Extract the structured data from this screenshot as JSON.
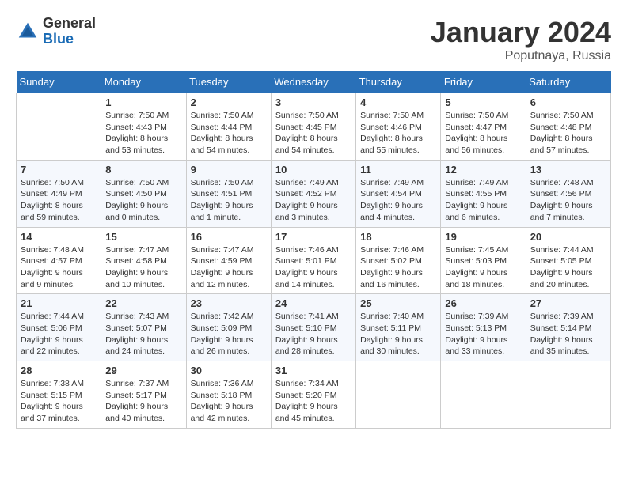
{
  "header": {
    "logo_general": "General",
    "logo_blue": "Blue",
    "month": "January 2024",
    "location": "Poputnaya, Russia"
  },
  "days_of_week": [
    "Sunday",
    "Monday",
    "Tuesday",
    "Wednesday",
    "Thursday",
    "Friday",
    "Saturday"
  ],
  "weeks": [
    [
      {
        "day": "",
        "sunrise": "",
        "sunset": "",
        "daylight": ""
      },
      {
        "day": "1",
        "sunrise": "Sunrise: 7:50 AM",
        "sunset": "Sunset: 4:43 PM",
        "daylight": "Daylight: 8 hours and 53 minutes."
      },
      {
        "day": "2",
        "sunrise": "Sunrise: 7:50 AM",
        "sunset": "Sunset: 4:44 PM",
        "daylight": "Daylight: 8 hours and 54 minutes."
      },
      {
        "day": "3",
        "sunrise": "Sunrise: 7:50 AM",
        "sunset": "Sunset: 4:45 PM",
        "daylight": "Daylight: 8 hours and 54 minutes."
      },
      {
        "day": "4",
        "sunrise": "Sunrise: 7:50 AM",
        "sunset": "Sunset: 4:46 PM",
        "daylight": "Daylight: 8 hours and 55 minutes."
      },
      {
        "day": "5",
        "sunrise": "Sunrise: 7:50 AM",
        "sunset": "Sunset: 4:47 PM",
        "daylight": "Daylight: 8 hours and 56 minutes."
      },
      {
        "day": "6",
        "sunrise": "Sunrise: 7:50 AM",
        "sunset": "Sunset: 4:48 PM",
        "daylight": "Daylight: 8 hours and 57 minutes."
      }
    ],
    [
      {
        "day": "7",
        "sunrise": "Sunrise: 7:50 AM",
        "sunset": "Sunset: 4:49 PM",
        "daylight": "Daylight: 8 hours and 59 minutes."
      },
      {
        "day": "8",
        "sunrise": "Sunrise: 7:50 AM",
        "sunset": "Sunset: 4:50 PM",
        "daylight": "Daylight: 9 hours and 0 minutes."
      },
      {
        "day": "9",
        "sunrise": "Sunrise: 7:50 AM",
        "sunset": "Sunset: 4:51 PM",
        "daylight": "Daylight: 9 hours and 1 minute."
      },
      {
        "day": "10",
        "sunrise": "Sunrise: 7:49 AM",
        "sunset": "Sunset: 4:52 PM",
        "daylight": "Daylight: 9 hours and 3 minutes."
      },
      {
        "day": "11",
        "sunrise": "Sunrise: 7:49 AM",
        "sunset": "Sunset: 4:54 PM",
        "daylight": "Daylight: 9 hours and 4 minutes."
      },
      {
        "day": "12",
        "sunrise": "Sunrise: 7:49 AM",
        "sunset": "Sunset: 4:55 PM",
        "daylight": "Daylight: 9 hours and 6 minutes."
      },
      {
        "day": "13",
        "sunrise": "Sunrise: 7:48 AM",
        "sunset": "Sunset: 4:56 PM",
        "daylight": "Daylight: 9 hours and 7 minutes."
      }
    ],
    [
      {
        "day": "14",
        "sunrise": "Sunrise: 7:48 AM",
        "sunset": "Sunset: 4:57 PM",
        "daylight": "Daylight: 9 hours and 9 minutes."
      },
      {
        "day": "15",
        "sunrise": "Sunrise: 7:47 AM",
        "sunset": "Sunset: 4:58 PM",
        "daylight": "Daylight: 9 hours and 10 minutes."
      },
      {
        "day": "16",
        "sunrise": "Sunrise: 7:47 AM",
        "sunset": "Sunset: 4:59 PM",
        "daylight": "Daylight: 9 hours and 12 minutes."
      },
      {
        "day": "17",
        "sunrise": "Sunrise: 7:46 AM",
        "sunset": "Sunset: 5:01 PM",
        "daylight": "Daylight: 9 hours and 14 minutes."
      },
      {
        "day": "18",
        "sunrise": "Sunrise: 7:46 AM",
        "sunset": "Sunset: 5:02 PM",
        "daylight": "Daylight: 9 hours and 16 minutes."
      },
      {
        "day": "19",
        "sunrise": "Sunrise: 7:45 AM",
        "sunset": "Sunset: 5:03 PM",
        "daylight": "Daylight: 9 hours and 18 minutes."
      },
      {
        "day": "20",
        "sunrise": "Sunrise: 7:44 AM",
        "sunset": "Sunset: 5:05 PM",
        "daylight": "Daylight: 9 hours and 20 minutes."
      }
    ],
    [
      {
        "day": "21",
        "sunrise": "Sunrise: 7:44 AM",
        "sunset": "Sunset: 5:06 PM",
        "daylight": "Daylight: 9 hours and 22 minutes."
      },
      {
        "day": "22",
        "sunrise": "Sunrise: 7:43 AM",
        "sunset": "Sunset: 5:07 PM",
        "daylight": "Daylight: 9 hours and 24 minutes."
      },
      {
        "day": "23",
        "sunrise": "Sunrise: 7:42 AM",
        "sunset": "Sunset: 5:09 PM",
        "daylight": "Daylight: 9 hours and 26 minutes."
      },
      {
        "day": "24",
        "sunrise": "Sunrise: 7:41 AM",
        "sunset": "Sunset: 5:10 PM",
        "daylight": "Daylight: 9 hours and 28 minutes."
      },
      {
        "day": "25",
        "sunrise": "Sunrise: 7:40 AM",
        "sunset": "Sunset: 5:11 PM",
        "daylight": "Daylight: 9 hours and 30 minutes."
      },
      {
        "day": "26",
        "sunrise": "Sunrise: 7:39 AM",
        "sunset": "Sunset: 5:13 PM",
        "daylight": "Daylight: 9 hours and 33 minutes."
      },
      {
        "day": "27",
        "sunrise": "Sunrise: 7:39 AM",
        "sunset": "Sunset: 5:14 PM",
        "daylight": "Daylight: 9 hours and 35 minutes."
      }
    ],
    [
      {
        "day": "28",
        "sunrise": "Sunrise: 7:38 AM",
        "sunset": "Sunset: 5:15 PM",
        "daylight": "Daylight: 9 hours and 37 minutes."
      },
      {
        "day": "29",
        "sunrise": "Sunrise: 7:37 AM",
        "sunset": "Sunset: 5:17 PM",
        "daylight": "Daylight: 9 hours and 40 minutes."
      },
      {
        "day": "30",
        "sunrise": "Sunrise: 7:36 AM",
        "sunset": "Sunset: 5:18 PM",
        "daylight": "Daylight: 9 hours and 42 minutes."
      },
      {
        "day": "31",
        "sunrise": "Sunrise: 7:34 AM",
        "sunset": "Sunset: 5:20 PM",
        "daylight": "Daylight: 9 hours and 45 minutes."
      },
      {
        "day": "",
        "sunrise": "",
        "sunset": "",
        "daylight": ""
      },
      {
        "day": "",
        "sunrise": "",
        "sunset": "",
        "daylight": ""
      },
      {
        "day": "",
        "sunrise": "",
        "sunset": "",
        "daylight": ""
      }
    ]
  ]
}
